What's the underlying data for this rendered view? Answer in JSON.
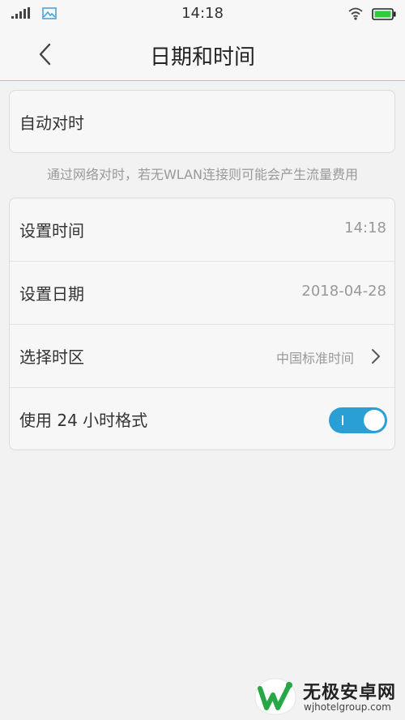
{
  "status_bar": {
    "time": "14:18"
  },
  "nav": {
    "title": "日期和时间"
  },
  "auto_sync": {
    "label": "自动对时",
    "hint": "通过网络对时，若无WLAN连接则可能会产生流量费用"
  },
  "settings": {
    "set_time": {
      "label": "设置时间",
      "value": "14:18"
    },
    "set_date": {
      "label": "设置日期",
      "value": "2018-04-28"
    },
    "time_zone": {
      "label": "选择时区",
      "value": "中国标准时间"
    },
    "format_24h": {
      "label": "使用 24 小时格式",
      "enabled": true
    }
  },
  "watermark": {
    "title": "无极安卓网",
    "url": "wjhotelgroup.com"
  },
  "colors": {
    "accent": "#2a9fd6",
    "divider_accent": "#f0b48a",
    "watermark_green": "#27a745"
  }
}
